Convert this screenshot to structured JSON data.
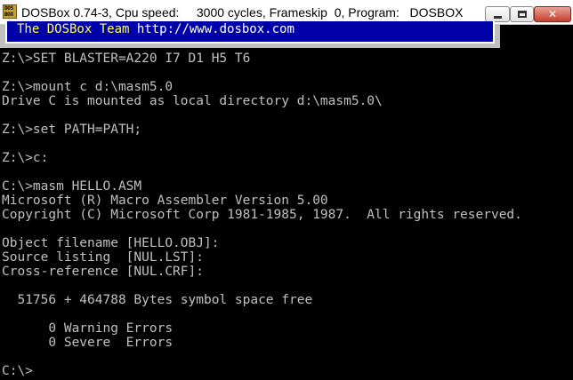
{
  "window": {
    "title": "DOSBox 0.74-3, Cpu speed:     3000 cycles, Frameskip  0, Program:   DOSBOX",
    "icon_label": "DOS BOX",
    "buttons": {
      "minimize": "minimize",
      "maximize": "maximize",
      "close": "✕"
    }
  },
  "banner": {
    "team": "The DOSBox Team",
    "url": "http://www.dosbox.com"
  },
  "terminal": {
    "lines": [
      "Z:\\>SET BLASTER=A220 I7 D1 H5 T6",
      "",
      "Z:\\>mount c d:\\masm5.0",
      "Drive C is mounted as local directory d:\\masm5.0\\",
      "",
      "Z:\\>set PATH=PATH;",
      "",
      "Z:\\>c:",
      "",
      "C:\\>masm HELLO.ASM",
      "Microsoft (R) Macro Assembler Version 5.00",
      "Copyright (C) Microsoft Corp 1981-1985, 1987.  All rights reserved.",
      "",
      "Object filename [HELLO.OBJ]:",
      "Source listing  [NUL.LST]:",
      "Cross-reference [NUL.CRF]:",
      "",
      "  51756 + 464788 Bytes symbol space free",
      "",
      "      0 Warning Errors",
      "      0 Severe  Errors",
      "",
      "C:\\>"
    ]
  }
}
